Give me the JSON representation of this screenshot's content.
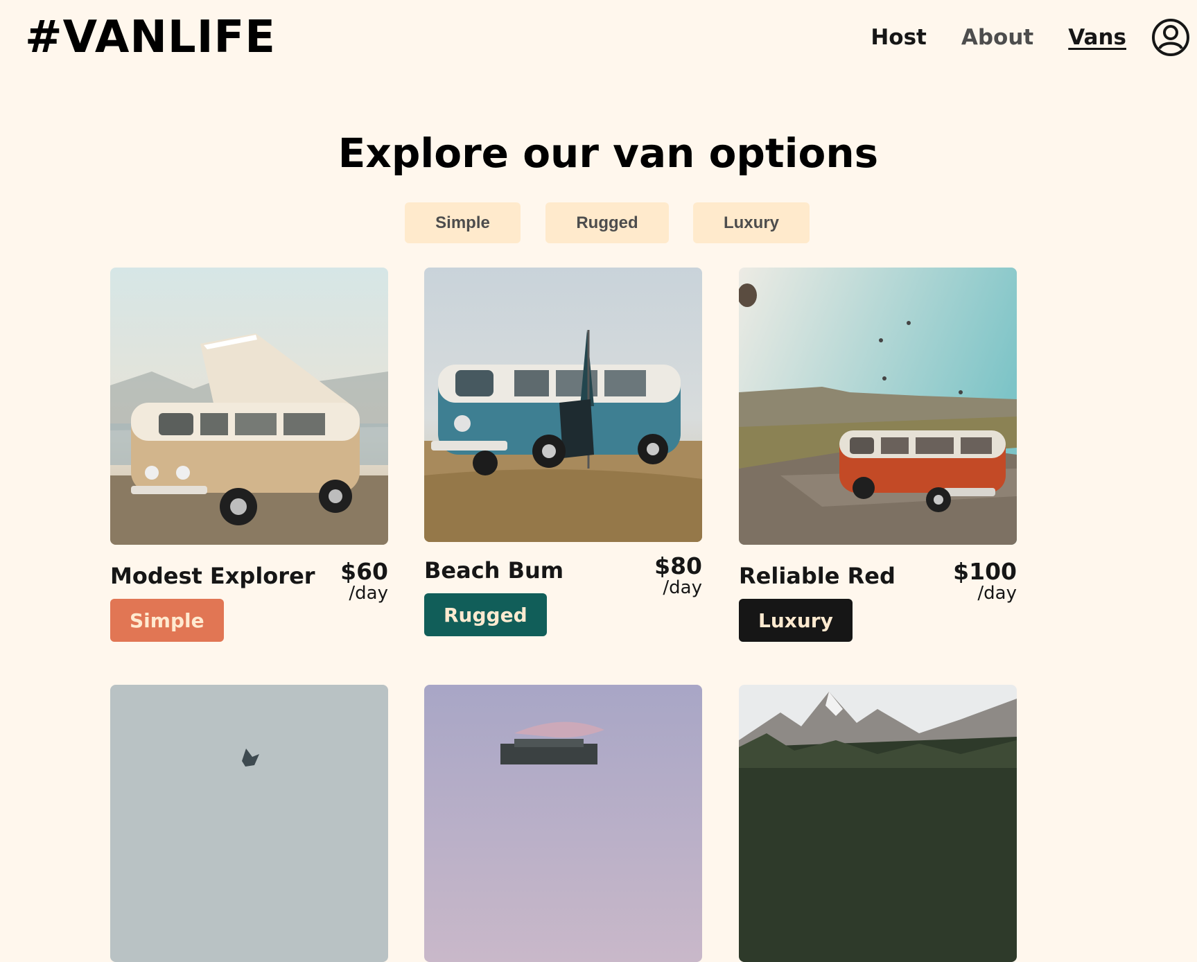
{
  "header": {
    "logo": "#VANLIFE",
    "nav": [
      {
        "label": "Host"
      },
      {
        "label": "About"
      },
      {
        "label": "Vans"
      }
    ]
  },
  "page": {
    "title": "Explore our van options"
  },
  "filters": [
    {
      "label": "Simple"
    },
    {
      "label": "Rugged"
    },
    {
      "label": "Luxury"
    }
  ],
  "vans": [
    {
      "name": "Modest Explorer",
      "price": "$60",
      "per": "/day",
      "type": "Simple"
    },
    {
      "name": "Beach Bum",
      "price": "$80",
      "per": "/day",
      "type": "Rugged"
    },
    {
      "name": "Reliable Red",
      "price": "$100",
      "per": "/day",
      "type": "Luxury"
    }
  ],
  "colors": {
    "background": "#FFF7ED",
    "filter_bg": "#FFEACC",
    "simple": "#E17654",
    "rugged": "#115E59",
    "luxury": "#161616"
  }
}
